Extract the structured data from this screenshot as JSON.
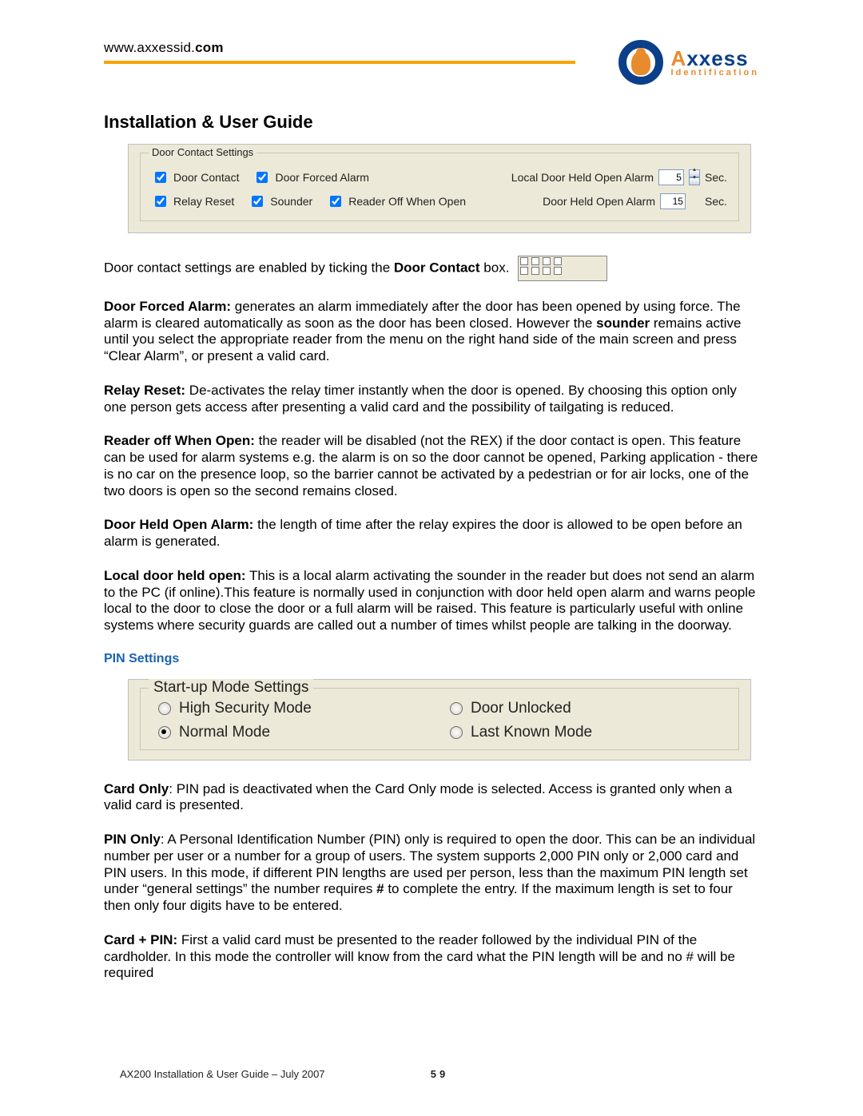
{
  "header": {
    "url_prefix": "www.axxessid.",
    "url_bold": "com",
    "brand_main": "xxess",
    "brand_a": "A",
    "brand_sub": "Identification"
  },
  "title": "Installation & User Guide",
  "shot1": {
    "legend": "Door Contact Settings",
    "door_contact": "Door Contact",
    "door_forced": "Door Forced Alarm",
    "relay_reset": "Relay Reset",
    "sounder": "Sounder",
    "reader_off": "Reader Off When Open",
    "local_alarm_label": "Local Door Held Open Alarm",
    "local_alarm_value": "5",
    "held_alarm_label": "Door Held Open Alarm",
    "held_alarm_value": "15",
    "sec": "Sec."
  },
  "p_intro_pre": "Door contact settings are enabled by ticking the ",
  "p_intro_b": "Door Contact",
  "p_intro_post": " box. ",
  "p_dfa_b": "Door Forced Alarm:",
  "p_dfa": " generates an alarm immediately after the door has been opened by using force. The alarm is cleared automatically as soon as the door has been closed. However the ",
  "p_dfa_b2": "sounder",
  "p_dfa2": " remains active until you select the appropriate reader from the menu on the right hand side of the main screen and press “Clear Alarm”, or present a valid card.",
  "p_rr_b": "Relay Reset:",
  "p_rr": " De-activates the relay timer instantly when the door is opened. By choosing this option only one person gets access after presenting a valid card and the possibility of tailgating is reduced.",
  "p_ro_b": "Reader off When Open:",
  "p_ro": " the reader will be disabled (not the REX) if the door contact is open. This feature can be used for alarm systems e.g. the alarm is on so the door cannot be opened, Parking application - there is no car on the presence loop, so the barrier cannot be activated by a pedestrian or for air locks, one of the two doors is open so the second remains closed.",
  "p_dh_b": "Door Held Open Alarm:",
  "p_dh": " the length of time after the relay expires the door is allowed to be open before an alarm is generated.",
  "p_ld_b": "Local door held open:",
  "p_ld": " This is a local alarm activating the sounder in the reader but does not send an alarm to the PC (if online).This feature is normally used in conjunction with door held open alarm and warns people local to the door to close the door or a full alarm will be raised. This feature is particularly useful with online systems where security guards are called out a number of times whilst people are talking in the doorway.",
  "pin_heading": "PIN Settings",
  "shot2": {
    "legend": "Start-up Mode Settings",
    "o1": "High Security Mode",
    "o2": "Normal Mode",
    "o3": "Door Unlocked",
    "o4": "Last Known Mode"
  },
  "p_co_b": "Card Only",
  "p_co": ": PIN pad is deactivated when the Card Only mode is selected. Access is granted only when a valid card is presented.",
  "p_po_b": "PIN Only",
  "p_po": ": A Personal Identification Number (PIN) only is required to open the door. This can be an individual number per user or a number for a group of users. The system supports 2,000 PIN only or 2,000 card and PIN users.  In this mode, if different PIN lengths are used per person, less than the maximum PIN length set under “general settings” the number requires ",
  "p_po_hash": "#",
  "p_po2": " to complete the entry. If the maximum length is set to four then only four digits have to be entered.",
  "p_cp_b": "Card + PIN:",
  "p_cp": " First a valid card must be presented to the reader followed by the individual PIN of the cardholder. In this mode the controller will know from the card what the PIN length will be and no # will be required",
  "footer": {
    "left": "AX200 Installation & User Guide – July 2007",
    "page": "59"
  }
}
